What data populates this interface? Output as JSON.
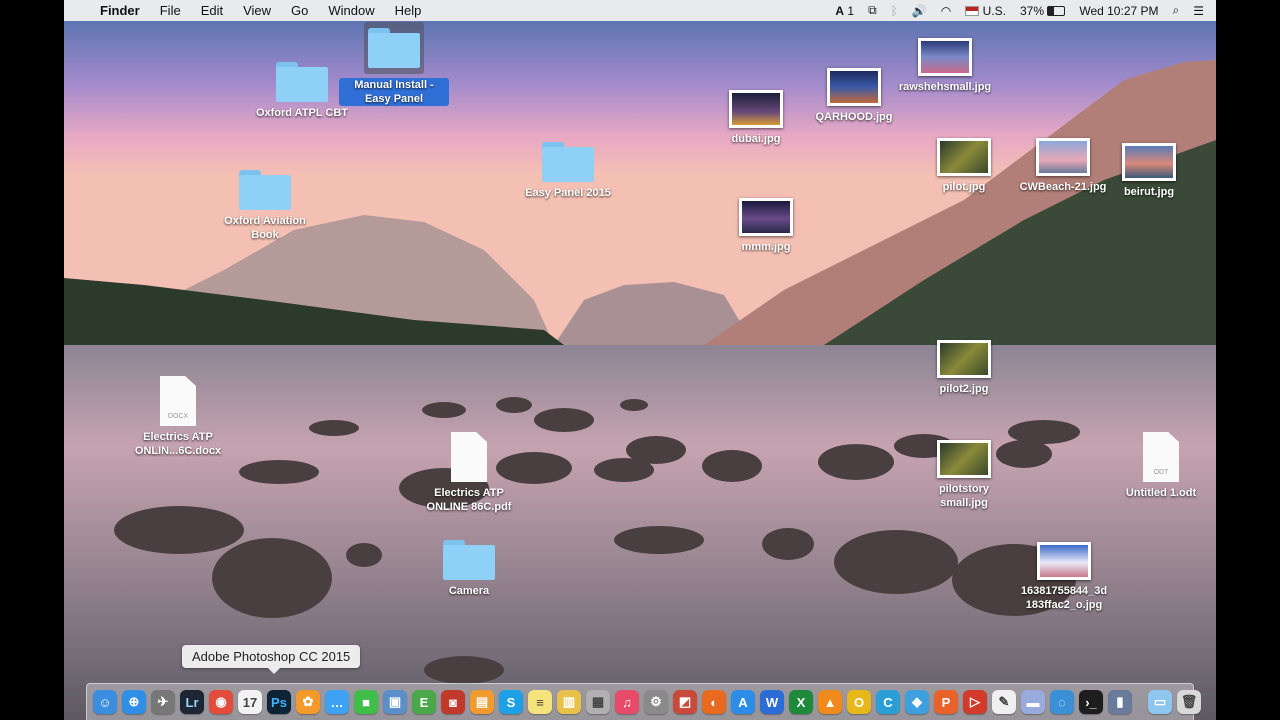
{
  "menubar": {
    "app": "Finder",
    "menus": [
      "File",
      "Edit",
      "View",
      "Go",
      "Window",
      "Help"
    ],
    "adobe_count": "1",
    "input_source": "U.S.",
    "battery": "37%",
    "clock": "Wed 10:27 PM"
  },
  "desktop": {
    "items": [
      {
        "label": "Oxford ATPL CBT",
        "kind": "folder"
      },
      {
        "label": "Manual Install - Easy Panel",
        "kind": "folder",
        "selected": true
      },
      {
        "label": "Oxford Aviation Book",
        "kind": "folder"
      },
      {
        "label": "Easy Panel 2015",
        "kind": "folder"
      },
      {
        "label": "dubai.jpg",
        "kind": "image"
      },
      {
        "label": "QARHOOD.jpg",
        "kind": "image"
      },
      {
        "label": "rawshehsmall.jpg",
        "kind": "image"
      },
      {
        "label": "pilot.jpg",
        "kind": "image"
      },
      {
        "label": "CWBeach-21.jpg",
        "kind": "image"
      },
      {
        "label": "beirut.jpg",
        "kind": "image"
      },
      {
        "label": "mmm.jpg",
        "kind": "image"
      },
      {
        "label": "pilot2.jpg",
        "kind": "image"
      },
      {
        "label": "Electrics ATP ONLIN...6C.docx",
        "kind": "doc",
        "ext": "DOCX"
      },
      {
        "label": "Electrics ATP ONLINE 86C.pdf",
        "kind": "doc",
        "ext": ""
      },
      {
        "label": "pilotstory small.jpg",
        "kind": "image"
      },
      {
        "label": "Untitled 1.odt",
        "kind": "doc",
        "ext": "ODT"
      },
      {
        "label": "Camera",
        "kind": "folder"
      },
      {
        "label": "16381755844_3d 183ffac2_o.jpg",
        "kind": "image"
      }
    ]
  },
  "tooltip": "Adobe Photoshop CC 2015",
  "dock": [
    {
      "name": "finder-icon",
      "glyph": "☺",
      "color": "#3b8de0"
    },
    {
      "name": "safari-icon",
      "glyph": "⊕",
      "color": "#2f8fe6"
    },
    {
      "name": "launchpad-icon",
      "glyph": "✈",
      "color": "#777"
    },
    {
      "name": "lightroom-icon",
      "glyph": "Lr",
      "color": "#1c2733"
    },
    {
      "name": "chrome-icon",
      "glyph": "◉",
      "color": "#e34b3a"
    },
    {
      "name": "calendar-icon",
      "glyph": "17",
      "color": "#f2f2f2"
    },
    {
      "name": "photoshop-icon",
      "glyph": "Ps",
      "color": "#0d2436"
    },
    {
      "name": "photos-icon",
      "glyph": "✿",
      "color": "#f39a2b"
    },
    {
      "name": "messages-icon",
      "glyph": "…",
      "color": "#3ea1f4"
    },
    {
      "name": "facetime-icon",
      "glyph": "■",
      "color": "#3fbf4a"
    },
    {
      "name": "preview-icon",
      "glyph": "▣",
      "color": "#5a8fc9"
    },
    {
      "name": "evernote-icon",
      "glyph": "E",
      "color": "#4aa84a"
    },
    {
      "name": "photobooth-icon",
      "glyph": "◙",
      "color": "#c0392b"
    },
    {
      "name": "ibooks-icon",
      "glyph": "▤",
      "color": "#f19a2e"
    },
    {
      "name": "skype-icon",
      "glyph": "S",
      "color": "#1ea0e6"
    },
    {
      "name": "notes-icon",
      "glyph": "≡",
      "color": "#f6e27a"
    },
    {
      "name": "stickies-icon",
      "glyph": "▥",
      "color": "#e8c14a"
    },
    {
      "name": "image-capture-icon",
      "glyph": "▦",
      "color": "#b0b0b0"
    },
    {
      "name": "itunes-icon",
      "glyph": "♫",
      "color": "#e84a6a"
    },
    {
      "name": "system-preferences-icon",
      "glyph": "⚙",
      "color": "#8a8a8a"
    },
    {
      "name": "grapher-icon",
      "glyph": "◩",
      "color": "#c94a3a"
    },
    {
      "name": "firefox-icon",
      "glyph": "◐",
      "color": "#e86a1f"
    },
    {
      "name": "app-store-icon",
      "glyph": "A",
      "color": "#2c8de8"
    },
    {
      "name": "word-icon",
      "glyph": "W",
      "color": "#2b6cd6"
    },
    {
      "name": "excel-icon",
      "glyph": "X",
      "color": "#1f8a3c"
    },
    {
      "name": "vlc-icon",
      "glyph": "▲",
      "color": "#f08a1a"
    },
    {
      "name": "outlook-icon",
      "glyph": "O",
      "color": "#e8b81a"
    },
    {
      "name": "cyberduck-icon",
      "glyph": "C",
      "color": "#2a9fd6"
    },
    {
      "name": "filemerge-icon",
      "glyph": "◆",
      "color": "#3fa0e0"
    },
    {
      "name": "powerpoint-icon",
      "glyph": "P",
      "color": "#e8622a"
    },
    {
      "name": "parallels-icon",
      "glyph": "▷",
      "color": "#d23a2a"
    },
    {
      "name": "textedit-icon",
      "glyph": "✎",
      "color": "#f0f0f0"
    },
    {
      "name": "folder-icon",
      "glyph": "▬",
      "color": "#9ad"
    },
    {
      "name": "migration-icon",
      "glyph": "◌",
      "color": "#3a8fd6"
    },
    {
      "name": "terminal-icon",
      "glyph": "›_",
      "color": "#1e1e1e"
    },
    {
      "name": "filmstrip-icon",
      "glyph": "▮",
      "color": "#6a7a9a"
    },
    {
      "name": "applications-folder-icon",
      "glyph": "▭",
      "color": "#8ec6ef"
    },
    {
      "name": "trash-icon",
      "glyph": "🗑",
      "color": "#d8d8d8"
    }
  ]
}
